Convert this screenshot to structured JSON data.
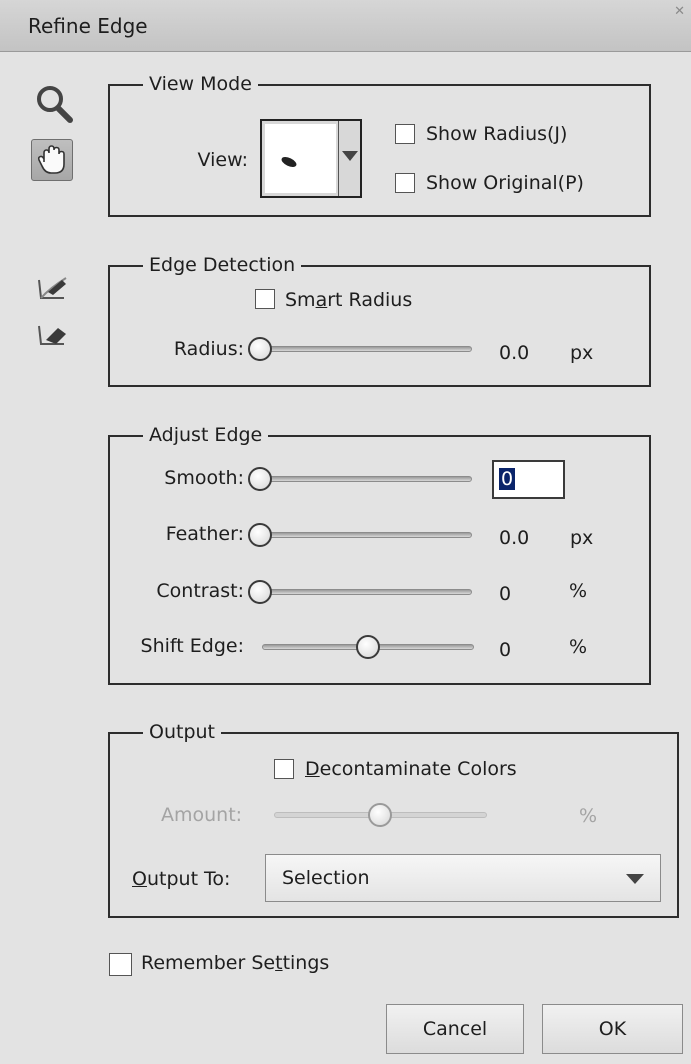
{
  "window": {
    "title": "Refine Edge"
  },
  "tools": {
    "zoom_icon": "magnifier-icon",
    "hand_icon": "hand-icon",
    "refine_radius_icon": "refine-radius-brush-icon",
    "erase_refinements_icon": "erase-refinements-brush-icon"
  },
  "view_mode": {
    "legend": "View Mode",
    "view_label": "View:",
    "show_radius": {
      "label": "Show Radius(J)",
      "checked": false
    },
    "show_original": {
      "label": "Show Original(P)",
      "checked": false
    }
  },
  "edge_detection": {
    "legend": "Edge Detection",
    "smart_radius": {
      "label_pre": "Sm",
      "label_u": "a",
      "label_post": "rt Radius",
      "checked": false
    },
    "radius": {
      "label": "Radius:",
      "value": "0.0",
      "unit": "px",
      "level": 0
    }
  },
  "adjust_edge": {
    "legend": "Adjust Edge",
    "smooth": {
      "label": "Smooth:",
      "value": "0",
      "level": 0
    },
    "feather": {
      "label": "Feather:",
      "value": "0.0",
      "unit": "px",
      "level": 0
    },
    "contrast": {
      "label": "Contrast:",
      "value": "0",
      "unit": "%",
      "level": 0
    },
    "shift_edge": {
      "label": "Shift Edge:",
      "value": "0",
      "unit": "%",
      "level": 0.5
    }
  },
  "output": {
    "legend": "Output",
    "decontaminate": {
      "label_u": "D",
      "label_post": "econtaminate Colors",
      "checked": false
    },
    "amount": {
      "label": "Amount:",
      "unit": "%",
      "level": 0.5,
      "enabled": false
    },
    "output_to": {
      "label_u": "O",
      "label_post": "utput To:",
      "value": "Selection"
    }
  },
  "remember": {
    "label_pre": "Remember Se",
    "label_u": "t",
    "label_post": "tings",
    "checked": false
  },
  "buttons": {
    "cancel": "Cancel",
    "ok": "OK"
  }
}
